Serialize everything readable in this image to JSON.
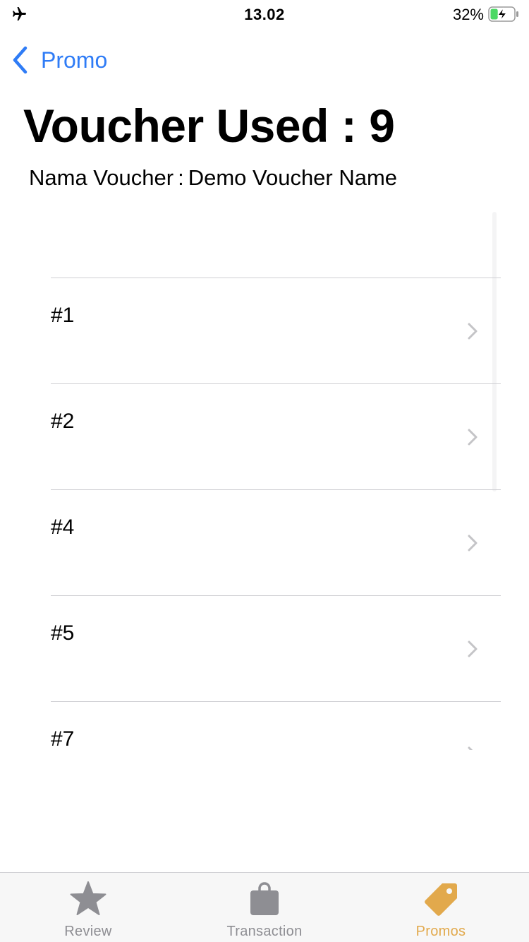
{
  "status_bar": {
    "time": "13.02",
    "battery_percent": "32%",
    "battery_level": 0.32,
    "airplane_icon": "airplane-icon",
    "battery_icon": "battery-charging-icon"
  },
  "nav": {
    "back_label": "Promo",
    "back_icon": "chevron-left-icon"
  },
  "header": {
    "title_label": "Voucher Used :",
    "title_count": "9",
    "voucher_label": "Nama Voucher",
    "voucher_separator": ":",
    "voucher_name": "Demo Voucher Name"
  },
  "list": {
    "items": [
      {
        "label": "#1"
      },
      {
        "label": "#2"
      },
      {
        "label": "#4"
      },
      {
        "label": "#5"
      },
      {
        "label": "#7"
      }
    ],
    "chevron_icon": "chevron-right-icon"
  },
  "tab_bar": {
    "tabs": [
      {
        "label": "Review",
        "icon": "star-icon",
        "active": false
      },
      {
        "label": "Transaction",
        "icon": "shopping-bag-icon",
        "active": false
      },
      {
        "label": "Promos",
        "icon": "tag-icon",
        "active": true
      }
    ]
  },
  "colors": {
    "accent": "#2f7cf6",
    "tab_active": "#e2a94c",
    "tab_inactive": "#8e8e93",
    "separator": "#cfcfd3",
    "battery_fill": "#4cd964"
  }
}
